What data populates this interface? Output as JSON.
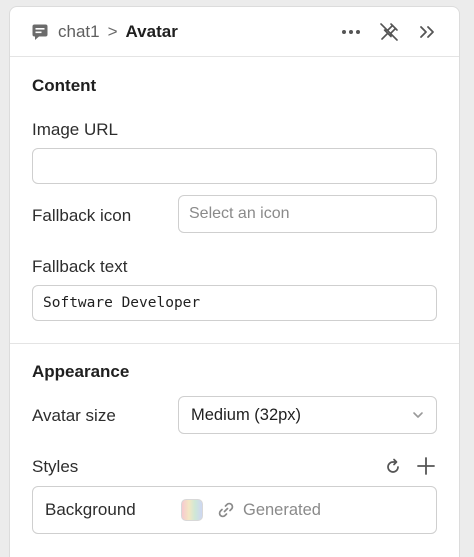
{
  "breadcrumb": {
    "component_icon": "component-icon",
    "parent": "chat1",
    "separator": ">",
    "current": "Avatar"
  },
  "header_actions": [
    {
      "icon": "more-horizontal-icon"
    },
    {
      "icon": "unpin-icon"
    },
    {
      "icon": "chevrons-right-icon"
    }
  ],
  "content": {
    "title": "Content",
    "image_url": {
      "label": "Image URL",
      "value": ""
    },
    "fallback_icon": {
      "label": "Fallback icon",
      "placeholder": "Select an icon"
    },
    "fallback_text": {
      "label": "Fallback text",
      "value": "Software Developer"
    }
  },
  "appearance": {
    "title": "Appearance",
    "avatar_size": {
      "label": "Avatar size",
      "value": "Medium (32px)"
    },
    "styles": {
      "label": "Styles",
      "background": {
        "label": "Background",
        "value": "Generated"
      }
    }
  },
  "colors": {
    "panel_bg": "#ffffff",
    "page_bg": "#ececec",
    "border": "#cfcfcf",
    "text": "#1f1f1f",
    "muted": "#8a8a8a"
  }
}
